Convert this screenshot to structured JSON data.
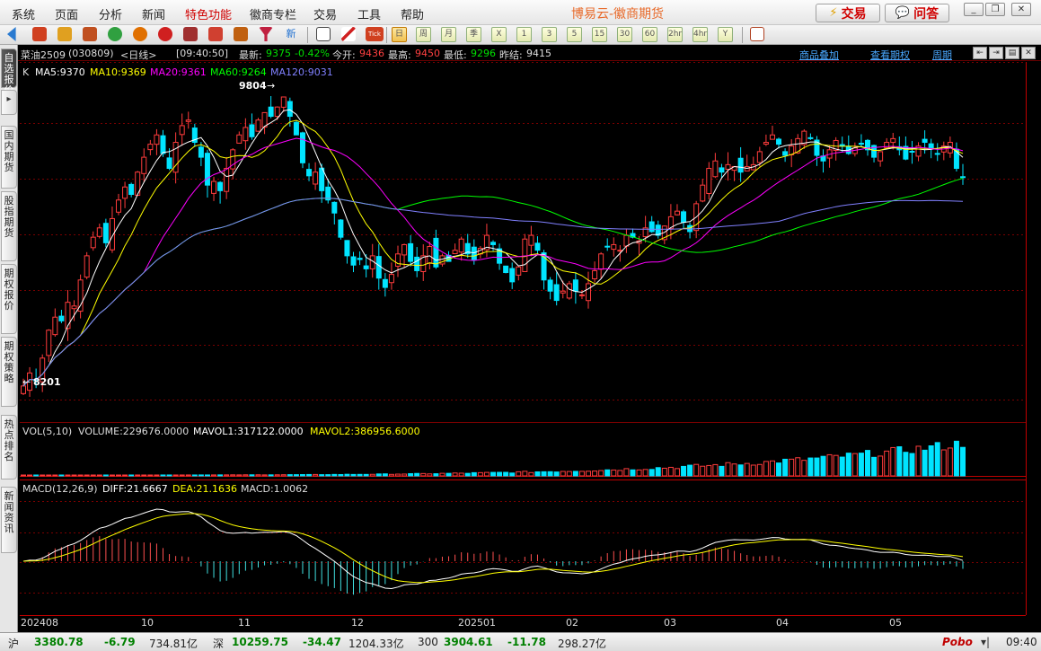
{
  "menu": {
    "items": [
      "系统",
      "页面",
      "分析",
      "新闻",
      "特色功能",
      "徽商专栏",
      "交易",
      "工具",
      "帮助"
    ],
    "highlighted_index": 4
  },
  "app_title": "博易云-徽商期货",
  "top_buttons": {
    "trade": "交易",
    "qa": "问答"
  },
  "toolbar": {
    "periods": [
      "日",
      "周",
      "月",
      "季",
      "X",
      "1",
      "3",
      "5",
      "15",
      "30",
      "60",
      "2hr",
      "4hr",
      "Y"
    ],
    "active_period": "日",
    "tick_label": "Tick",
    "new_label": "新"
  },
  "left_tabs": [
    "自选报价",
    "国内期货",
    "股指期货",
    "期权报价",
    "期权策略",
    "热点排名",
    "新闻资讯"
  ],
  "header": {
    "symbol": "菜油2509",
    "code": "(030809)",
    "period": "<日线>",
    "time": "[09:40:50]",
    "latest_label": "最新:",
    "latest": "9375",
    "change": "-0.42%",
    "open_label": "今开:",
    "open": "9436",
    "high_label": "最高:",
    "high": "9450",
    "low_label": "最低:",
    "low": "9296",
    "prev_label": "昨结:",
    "prev": "9415",
    "link_overlay": "商品叠加",
    "link_options": "查看期权",
    "link_period": "周期"
  },
  "ma_legend": {
    "k": "K",
    "ma5": "MA5:9370",
    "ma10": "MA10:9369",
    "ma20": "MA20:9361",
    "ma60": "MA60:9264",
    "ma120": "MA120:9031"
  },
  "price_marks": {
    "max": "9804",
    "min": "8201"
  },
  "vol_legend": {
    "name": "VOL(5,10)",
    "volume": "VOLUME:229676.0000",
    "mavol1": "MAVOL1:317122.0000",
    "mavol2": "MAVOL2:386956.6000"
  },
  "macd_legend": {
    "name": "MACD(12,26,9)",
    "diff": "DIFF:21.6667",
    "dea": "DEA:21.1636",
    "macd": "MACD:1.0062"
  },
  "date_axis": [
    "202408",
    "10",
    "11",
    "12",
    "202501",
    "02",
    "03",
    "04",
    "05"
  ],
  "status": {
    "sh_label": "沪",
    "sh_value": "3380.78",
    "sh_change": "-6.79",
    "sh_amount": "734.81亿",
    "sz_label": "深",
    "sz_value": "10259.75",
    "sz_change": "-34.47",
    "sz_amount": "1204.33亿",
    "i300_label": "300",
    "i300_value": "3904.61",
    "i300_change": "-11.78",
    "i300_amount": "298.27亿",
    "brand": "Pobo",
    "clock": "09:40"
  },
  "colors": {
    "up": "#ff3c3c",
    "down": "#00e4ff",
    "ma5": "#ffffff",
    "ma10": "#ffff00",
    "ma20": "#ff00ff",
    "ma60": "#00ff00",
    "ma120": "#8080ff",
    "grid": "#7a0000"
  },
  "chart_data": {
    "type": "candlestick",
    "symbol": "菜油2509",
    "period": "日线",
    "price_range": [
      8100,
      9900
    ],
    "closes": [
      8250,
      8320,
      8280,
      8400,
      8550,
      8620,
      8600,
      8700,
      8680,
      8820,
      8950,
      9050,
      9100,
      9020,
      9150,
      9250,
      9320,
      9280,
      9400,
      9480,
      9550,
      9600,
      9500,
      9420,
      9560,
      9650,
      9680,
      9560,
      9480,
      9330,
      9350,
      9300,
      9420,
      9520,
      9600,
      9640,
      9590,
      9680,
      9720,
      9700,
      9750,
      9804,
      9700,
      9600,
      9450,
      9380,
      9400,
      9300,
      9250,
      9180,
      9050,
      8950,
      8900,
      8930,
      8880,
      8950,
      8830,
      8780,
      8850,
      8960,
      9010,
      8920,
      8870,
      8950,
      9000,
      8890,
      8950,
      8920,
      8980,
      9040,
      8960,
      8930,
      8990,
      9060,
      9010,
      8910,
      8860,
      8810,
      8890,
      9040,
      9060,
      8980,
      8820,
      8760,
      8710,
      8760,
      8800,
      8760,
      8740,
      8800,
      8870,
      8960,
      9000,
      9010,
      8980,
      9060,
      9050,
      9030,
      9100,
      9080,
      9060,
      9110,
      9160,
      9190,
      9130,
      9080,
      9230,
      9330,
      9420,
      9460,
      9400,
      9440,
      9430,
      9400,
      9430,
      9440,
      9510,
      9560,
      9600,
      9550,
      9490,
      9540,
      9580,
      9620,
      9580,
      9490,
      9460,
      9520,
      9570,
      9540,
      9500,
      9530,
      9550,
      9520,
      9480,
      9510,
      9560,
      9580,
      9520,
      9470,
      9510,
      9540,
      9560,
      9530,
      9500,
      9540,
      9560,
      9420,
      9375
    ],
    "ma_values": {
      "ma5": 9370,
      "ma10": 9369,
      "ma20": 9361,
      "ma60": 9264,
      "ma120": 9031
    },
    "annotations": {
      "max": 9804,
      "min": 8201
    },
    "x_labels": [
      "202408",
      "10",
      "11",
      "12",
      "202501",
      "02",
      "03",
      "04",
      "05"
    ],
    "volume": {
      "volume": 229676.0,
      "mavol1": 317122.0,
      "mavol2": 386956.6
    },
    "macd": {
      "diff": 21.6667,
      "dea": 21.1636,
      "macd": 1.0062
    }
  }
}
